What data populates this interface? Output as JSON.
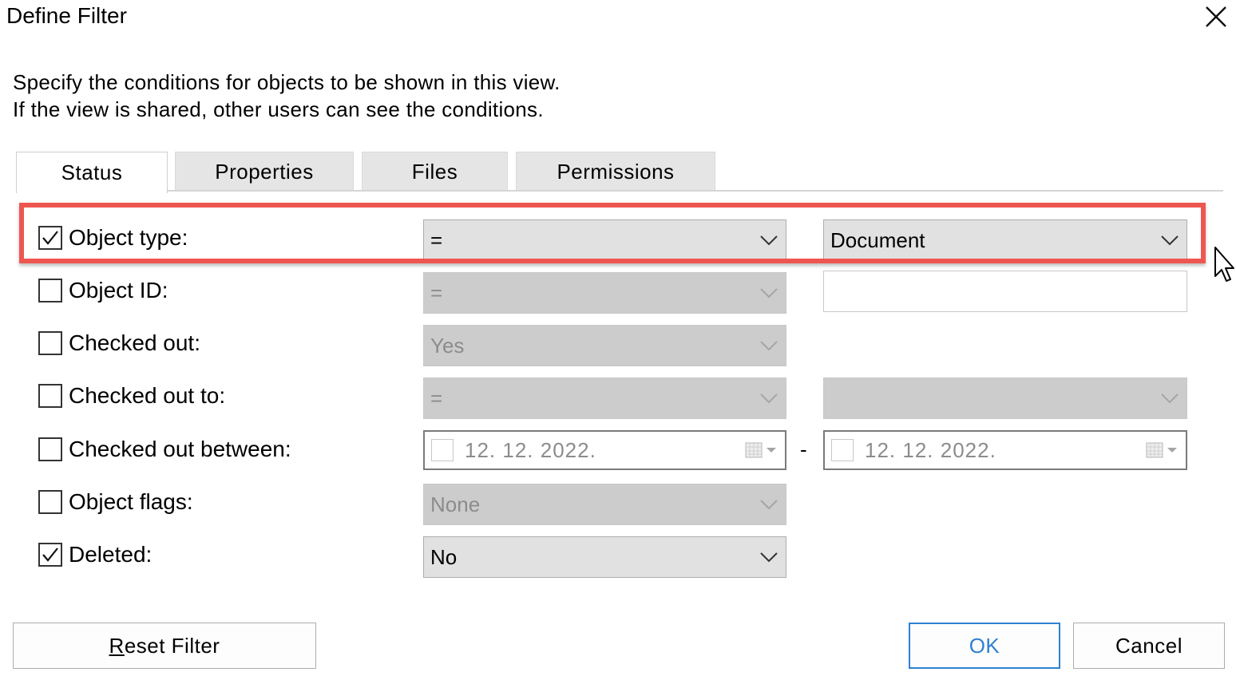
{
  "window": {
    "title": "Define Filter"
  },
  "description": {
    "line1": "Specify the conditions for objects to be shown in this view.",
    "line2": "If the view is shared, other users can see the conditions."
  },
  "tabs": [
    {
      "label": "Status",
      "active": true
    },
    {
      "label": "Properties",
      "active": false
    },
    {
      "label": "Files",
      "active": false
    },
    {
      "label": "Permissions",
      "active": false
    }
  ],
  "conditions": {
    "object_type": {
      "label": "Object type:",
      "checked": true,
      "operator": "=",
      "value": "Document"
    },
    "object_id": {
      "label": "Object ID:",
      "checked": false,
      "operator": "=",
      "value": ""
    },
    "checked_out": {
      "label": "Checked out:",
      "checked": false,
      "value": "Yes"
    },
    "checked_out_to": {
      "label": "Checked out to:",
      "checked": false,
      "operator": "=",
      "value": ""
    },
    "checked_out_between": {
      "label": "Checked out between:",
      "checked": false,
      "from": "12. 12. 2022.",
      "separator": "-",
      "to": "12. 12. 2022."
    },
    "object_flags": {
      "label": "Object flags:",
      "checked": false,
      "value": "None"
    },
    "deleted": {
      "label": "Deleted:",
      "checked": true,
      "value": "No"
    }
  },
  "buttons": {
    "reset": {
      "mnemonic": "R",
      "rest": "eset Filter"
    },
    "ok": "OK",
    "cancel": "Cancel"
  },
  "colors": {
    "highlight": "#ef5650",
    "primary_button": "#2f80d4",
    "combo_enabled": "#e1e1e1",
    "combo_disabled": "#cccccc"
  },
  "icons": [
    "close-icon",
    "check-icon",
    "chevron-down-icon",
    "calendar-icon",
    "mouse-cursor-icon"
  ]
}
